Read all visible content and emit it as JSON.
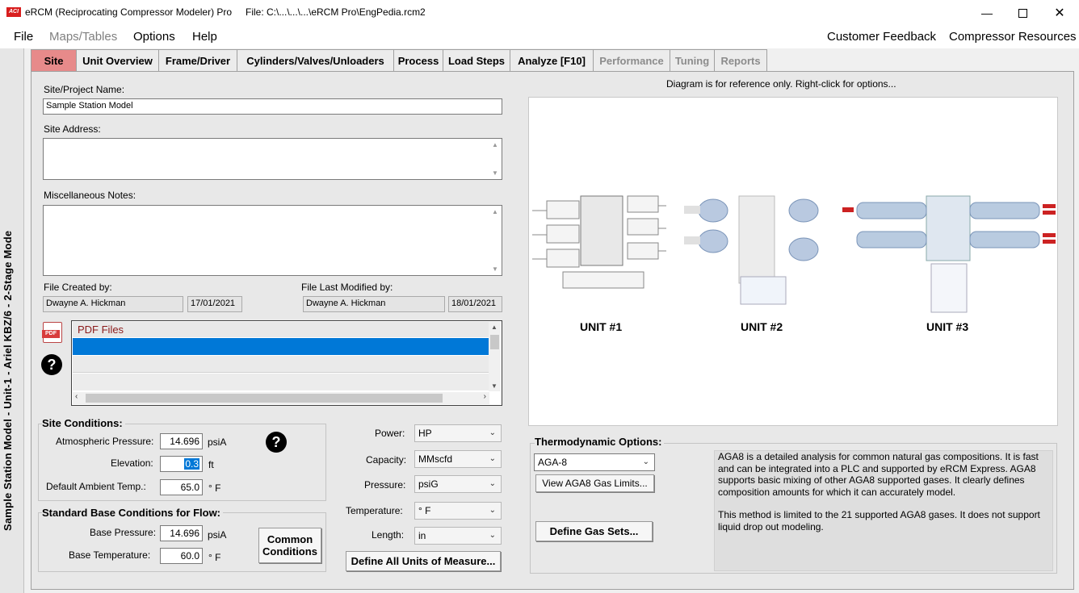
{
  "titlebar": {
    "app_icon": "ACI",
    "title": "eRCM (Reciprocating Compressor Modeler) Pro",
    "file": "File: C:\\...\\...\\...\\eRCM Pro\\EngPedia.rcm2",
    "minimize_icon": "minimize-icon",
    "maximize_icon": "maximize-icon",
    "close_icon": "close-icon"
  },
  "menu": {
    "file": "File",
    "maps_tables": "Maps/Tables",
    "options": "Options",
    "help": "Help",
    "customer_feedback": "Customer Feedback",
    "compressor_resources": "Compressor Resources"
  },
  "sidebar": {
    "mode_text": "Sample Station Model - Unit-1 - Ariel KBZ/6 - 2-Stage Mode"
  },
  "tabs": [
    {
      "label": "Site",
      "state": "active"
    },
    {
      "label": "Unit Overview",
      "state": "normal"
    },
    {
      "label": "Frame/Driver",
      "state": "normal"
    },
    {
      "label": "Cylinders/Valves/Unloaders",
      "state": "normal"
    },
    {
      "label": "Process",
      "state": "normal"
    },
    {
      "label": "Load Steps",
      "state": "normal"
    },
    {
      "label": "Analyze [F10]",
      "state": "normal"
    },
    {
      "label": "Performance",
      "state": "disabled"
    },
    {
      "label": "Tuning",
      "state": "disabled"
    },
    {
      "label": "Reports",
      "state": "disabled"
    }
  ],
  "site": {
    "project_name_label": "Site/Project Name:",
    "project_name_value": "Sample Station Model",
    "address_label": "Site Address:",
    "address_value": "",
    "notes_label": "Miscellaneous Notes:",
    "notes_value": "",
    "created_by_label": "File Created by:",
    "created_by": "Dwayne A. Hickman",
    "created_date": "17/01/2021",
    "modified_by_label": "File Last Modified by:",
    "modified_by": "Dwayne A. Hickman",
    "modified_date": "18/01/2021",
    "pdf_icon_text": "PDF",
    "pdf_list_header": "PDF Files"
  },
  "site_conditions": {
    "title": "Site Conditions:",
    "atm_pressure_label": "Atmospheric Pressure:",
    "atm_pressure_value": "14.696",
    "atm_pressure_unit": "psiA",
    "elevation_label": "Elevation:",
    "elevation_value": "0.3",
    "elevation_unit": "ft",
    "ambient_label": "Default Ambient Temp.:",
    "ambient_value": "65.0",
    "ambient_unit": "° F"
  },
  "base_conditions": {
    "title": "Standard Base Conditions for Flow:",
    "base_pressure_label": "Base Pressure:",
    "base_pressure_value": "14.696",
    "base_pressure_unit": "psiA",
    "base_temp_label": "Base Temperature:",
    "base_temp_value": "60.0",
    "base_temp_unit": "° F",
    "common_button": "Common Conditions"
  },
  "units": {
    "power_label": "Power:",
    "power_value": "HP",
    "capacity_label": "Capacity:",
    "capacity_value": "MMscfd",
    "pressure_label": "Pressure:",
    "pressure_value": "psiG",
    "temperature_label": "Temperature:",
    "temperature_value": "° F",
    "length_label": "Length:",
    "length_value": "in",
    "define_all_button": "Define All Units of Measure..."
  },
  "diagram": {
    "hint": "Diagram is for reference only. Right-click for options...",
    "unit1": "UNIT #1",
    "unit2": "UNIT #2",
    "unit3": "UNIT #3"
  },
  "thermo": {
    "title": "Thermodynamic Options:",
    "method": "AGA-8",
    "view_limits_button": "View AGA8 Gas Limits...",
    "define_gas_button": "Define Gas Sets...",
    "desc1": "AGA8 is a detailed analysis for common natural gas compositions. It is fast and can be integrated into a PLC and supported by eRCM Express. AGA8 supports basic mixing of other AGA8 supported gases. It clearly defines composition amounts for which it can accurately model.",
    "desc2": "This method is limited to the 21 supported AGA8 gases. It does not support liquid drop out modeling."
  },
  "colors": {
    "active_tab": "#e78a8a",
    "selection": "#0078d7",
    "pdf_header_text": "#8b1a1a"
  }
}
